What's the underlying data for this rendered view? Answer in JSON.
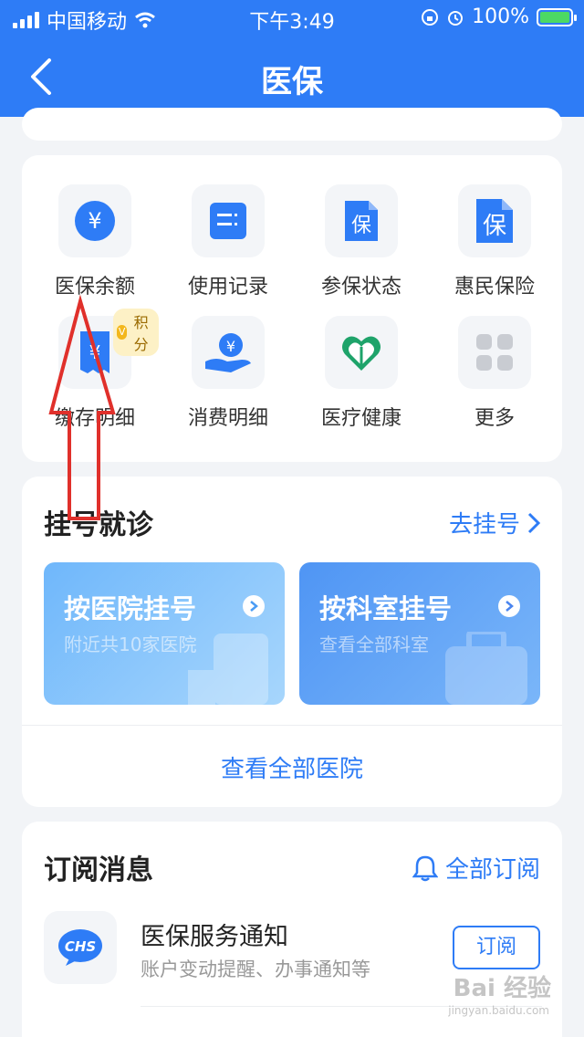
{
  "status_bar": {
    "carrier": "中国移动",
    "time": "下午3:49",
    "battery": "100%"
  },
  "header": {
    "title": "医保"
  },
  "services": {
    "items": [
      {
        "label": "医保余额",
        "icon": "yuan-coin-icon"
      },
      {
        "label": "使用记录",
        "icon": "record-list-icon"
      },
      {
        "label": "参保状态",
        "icon": "insurance-doc-icon",
        "glyph": "保"
      },
      {
        "label": "惠民保险",
        "icon": "insurance-doc-icon",
        "glyph": "保"
      },
      {
        "label": "缴存明细",
        "icon": "receipt-icon",
        "badge": "积分"
      },
      {
        "label": "消费明细",
        "icon": "hand-coin-icon"
      },
      {
        "label": "医疗健康",
        "icon": "heart-icon"
      },
      {
        "label": "更多",
        "icon": "grid-more-icon"
      }
    ]
  },
  "registration": {
    "title": "挂号就诊",
    "link": "去挂号",
    "cards": [
      {
        "title": "按医院挂号",
        "subtitle": "附近共10家医院"
      },
      {
        "title": "按科室挂号",
        "subtitle": "查看全部科室"
      }
    ],
    "view_all": "查看全部医院"
  },
  "subscriptions": {
    "title": "订阅消息",
    "link": "全部订阅",
    "items": [
      {
        "logo": "CHS",
        "title": "医保服务通知",
        "desc": "账户变动提醒、办事通知等",
        "button": "订阅"
      }
    ]
  },
  "watermark": {
    "text": "Bai 经验",
    "sub": "jingyan.baidu.com"
  },
  "colors": {
    "brand_blue": "#2e7cf6",
    "annotation_red": "#e0302b"
  }
}
